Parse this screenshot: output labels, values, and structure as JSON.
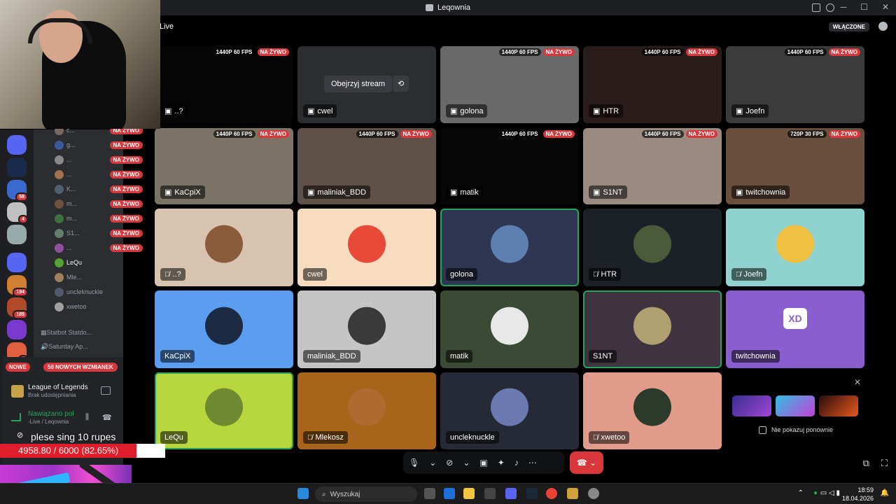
{
  "window": {
    "title": "Leqownia"
  },
  "header": {
    "live_text": "Live",
    "toggle_label": "WŁĄCZONE"
  },
  "stream_tiles": [
    {
      "name": "..?",
      "fps": "1440P 60 FPS",
      "live": "NA ŻYWO"
    },
    {
      "name": "cwel",
      "watch_label": "Obejrzyj stream"
    },
    {
      "name": "golona",
      "fps": "1440P 60 FPS",
      "live": "NA ŻYWO"
    },
    {
      "name": "HTR",
      "fps": "1440P 60 FPS",
      "live": "NA ŻYWO"
    },
    {
      "name": "Joefn",
      "fps": "1440P 60 FPS",
      "live": "NA ŻYWO"
    },
    {
      "name": "KaCpiX",
      "fps": "1440P 60 FPS",
      "live": "NA ŻYWO"
    },
    {
      "name": "maliniak_BDD",
      "fps": "1440P 60 FPS",
      "live": "NA ŻYWO"
    },
    {
      "name": "matik",
      "fps": "1440P 60 FPS",
      "live": "NA ŻYWO"
    },
    {
      "name": "S1NT",
      "fps": "1440P 60 FPS",
      "live": "NA ŻYWO"
    },
    {
      "name": "twitchownia",
      "fps": "720P 30 FPS",
      "live": "NA ŻYWO"
    }
  ],
  "user_tiles": [
    {
      "name": "..?",
      "muted": true,
      "color": "#d8c3b0"
    },
    {
      "name": "cwel",
      "muted": false,
      "color": "#f8dcc0"
    },
    {
      "name": "golona",
      "muted": false,
      "color": "#2e3651",
      "speaking": true
    },
    {
      "name": "HTR",
      "muted": true,
      "color": "#1b2127"
    },
    {
      "name": "Joefn",
      "muted": true,
      "color": "#8fd2cf"
    },
    {
      "name": "KaCpiX",
      "muted": false,
      "color": "#5b9ef0"
    },
    {
      "name": "maliniak_BDD",
      "muted": false,
      "color": "#c5c5c5"
    },
    {
      "name": "matik",
      "muted": false,
      "color": "#3a4a34"
    },
    {
      "name": "S1NT",
      "muted": false,
      "color": "#3f3340",
      "speaking": true
    },
    {
      "name": "twitchownia",
      "muted": false,
      "color": "#8a5ecf",
      "avatar_text": "XD"
    },
    {
      "name": "LeQu",
      "muted": false,
      "color": "#b8d63e",
      "speaking": true
    },
    {
      "name": "Mlekosz",
      "muted": true,
      "color": "#a8641a"
    },
    {
      "name": "uncleknuckle",
      "muted": false,
      "color": "#262a36"
    },
    {
      "name": "xwetoo",
      "muted": true,
      "color": "#e19b8b"
    }
  ],
  "promo": {
    "checkbox_label": "Nie pokazuj ponownie"
  },
  "sidebar": {
    "voice_users": [
      {
        "name": "c...",
        "live": "NA ŻYWO"
      },
      {
        "name": "g...",
        "live": "NA ŻYWO"
      },
      {
        "name": "...",
        "live": "NA ŻYWO"
      },
      {
        "name": "...",
        "live": "NA ŻYWO"
      },
      {
        "name": "K...",
        "live": "NA ŻYWO"
      },
      {
        "name": "m...",
        "live": "NA ŻYWO"
      },
      {
        "name": "m...",
        "live": "NA ŻYWO"
      },
      {
        "name": "S1...",
        "live": "NA ŻYWO"
      },
      {
        "name": "...",
        "live": "NA ŻYWO"
      },
      {
        "name": "LeQu"
      },
      {
        "name": "Mle..."
      },
      {
        "name": "uncleknuckle"
      },
      {
        "name": "xwetoo"
      }
    ],
    "statbot_label": "Statbot Statdo...",
    "saturday_label": "Saturday Ap...",
    "new_label": "NOWE",
    "mentions_label": "58 NOWYCH WZMIANEK",
    "server_badges": [
      "58",
      "4",
      "194",
      "185",
      "7"
    ]
  },
  "activity": {
    "game": "League of Legends",
    "sub": "Brak udostępniania"
  },
  "connection": {
    "status": "Nawiązano poł",
    "channel": "-Live / Leqownia"
  },
  "overlay": {
    "donor_text": "plese sing 10 rupes",
    "hp_text": "4958.80 / 6000 (82.65%)",
    "hp_fraction": 0.8265
  },
  "taskbar": {
    "search_placeholder": "Wyszukaj",
    "time": "18:59",
    "date": "18.04.2026"
  }
}
